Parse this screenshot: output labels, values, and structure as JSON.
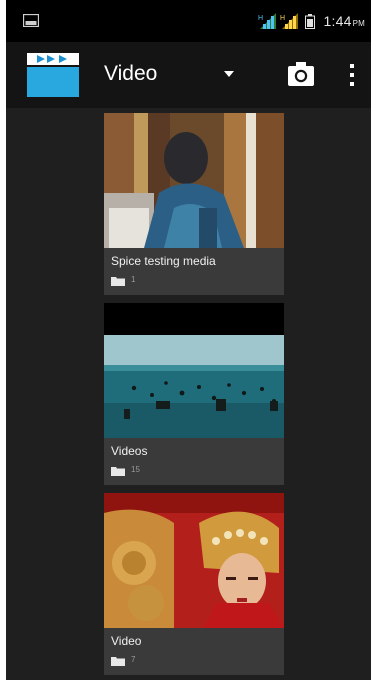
{
  "status_bar": {
    "time": "1:44",
    "ampm": "PM",
    "signal_color": "#4fc3f7",
    "signal2_color": "#ffd54f"
  },
  "action_bar": {
    "title": "Video",
    "icons": [
      "clapperboard-icon",
      "dropdown-icon",
      "camera-icon",
      "overflow-menu-icon"
    ],
    "accent": "#29a8e0"
  },
  "albums": [
    {
      "name": "Spice testing media",
      "count": "1"
    },
    {
      "name": "Videos",
      "count": "15"
    },
    {
      "name": "Video",
      "count": "7"
    }
  ]
}
